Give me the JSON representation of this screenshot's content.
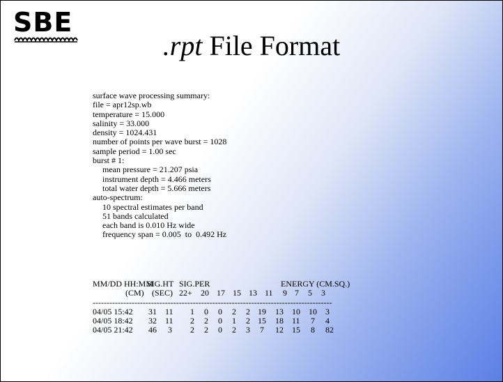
{
  "logo": {
    "text": "SBE"
  },
  "title": {
    "ext": ".rpt",
    "rest": " File Format"
  },
  "report": {
    "lines": [
      "surface wave processing summary:",
      "file = apr12sp.wb",
      "temperature = 15.000",
      "salinity = 33.000",
      "density = 1024.431",
      "number of points per wave burst = 1028",
      "sample period = 1.00 sec",
      "burst # 1:"
    ],
    "burst_lines": [
      "mean pressure = 21.207 psia",
      "instrument depth = 4.466 meters",
      "total water depth = 5.666 meters"
    ],
    "spectrum_header": "auto-spectrum:",
    "spectrum_lines": [
      "10 spectral estimates per band",
      "51 bands calculated",
      "each band is 0.010 Hz wide",
      "frequency span = 0.005  to  0.492 Hz"
    ]
  },
  "table": {
    "header1": {
      "datetime": "MM/DD HH:MM",
      "sight": "SIG.HT",
      "sigper": "SIG.PER",
      "energy": "ENERGY (CM.SQ.)"
    },
    "header2": {
      "cm": "(CM)",
      "sec": "(SEC)",
      "bands": [
        "22+",
        "20",
        "17",
        "15",
        "13",
        "11",
        "9",
        "7",
        "5",
        "3"
      ]
    },
    "separator": "--------------------------------------------------------------------------------------",
    "rows": [
      {
        "datetime": "04/05 15:42",
        "sight": "31",
        "sigper": "11",
        "bands": [
          "1",
          "0",
          "0",
          "2",
          "2",
          "19",
          "13",
          "10",
          "10",
          "3"
        ]
      },
      {
        "datetime": "04/05 18:42",
        "sight": "32",
        "sigper": "11",
        "bands": [
          "2",
          "2",
          "0",
          "1",
          "2",
          "15",
          "18",
          "11",
          "7",
          "4"
        ]
      },
      {
        "datetime": "04/05 21:42",
        "sight": "46",
        "sigper": "3",
        "bands": [
          "2",
          "2",
          "0",
          "2",
          "3",
          "7",
          "12",
          "15",
          "8",
          "82"
        ]
      }
    ]
  }
}
